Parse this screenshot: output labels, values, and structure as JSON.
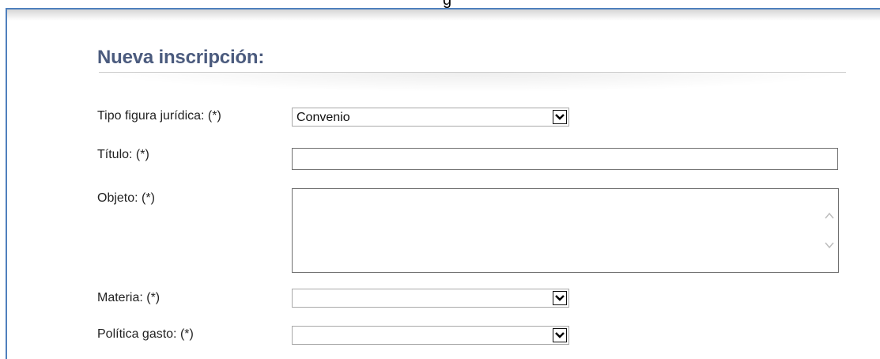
{
  "caption_fragment": "g",
  "form": {
    "title": "Nueva inscripción:",
    "fields": {
      "tipo_figura": {
        "label": "Tipo figura jurídica: (*)",
        "value": "Convenio"
      },
      "titulo": {
        "label": "Título: (*)",
        "value": ""
      },
      "objeto": {
        "label": "Objeto: (*)",
        "value": ""
      },
      "materia": {
        "label": "Materia: (*)",
        "value": ""
      },
      "politica_gasto": {
        "label": "Política gasto: (*)",
        "value": ""
      }
    }
  },
  "icons": {
    "select_arrow": "chevron-down-icon",
    "scroll_up": "chevron-up-icon",
    "scroll_down": "chevron-down-icon"
  },
  "colors": {
    "title": "#4b5b7e",
    "frame_border": "#4f80bd",
    "label_text": "#222222",
    "input_border": "#707070"
  }
}
